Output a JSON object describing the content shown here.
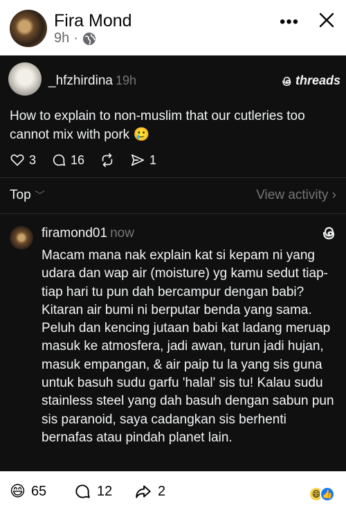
{
  "post": {
    "author": "Fira Mond",
    "time": "9h",
    "separator": "·"
  },
  "threads_post": {
    "username": "_hfzhirdina",
    "time": "19h",
    "brand": "threads",
    "text": "How to explain to non-muslim that our cutleries too cannot mix with pork 🥲",
    "likes": "3",
    "comments": "16",
    "shares": "1"
  },
  "threads_filter": {
    "sort": "Top",
    "view_activity": "View activity"
  },
  "threads_reply": {
    "username": "firamond01",
    "time": "now",
    "text": "Macam mana nak explain kat si kepam ni yang udara dan wap air (moisture) yg kamu sedut tiap-tiap hari tu pun dah bercampur dengan babi? Kitaran air bumi ni berputar benda yang sama. Peluh dan kencing jutaan babi kat ladang meruap masuk ke atmosfera, jadi awan, turun jadi hujan, masuk empangan, & air paip tu la yang sis guna untuk basuh sudu garfu 'halal' sis tu! Kalau sudu stainless steel yang dah basuh dengan sabun pun sis paranoid, saya cadangkan sis berhenti bernafas atau pindah planet lain."
  },
  "footer": {
    "reaction_emoji": "😄",
    "reactions": "65",
    "comments": "12",
    "shares": "2"
  },
  "colors": {
    "threads_bg": "#101010",
    "muted": "#777777",
    "like_blue": "#1877f2"
  }
}
